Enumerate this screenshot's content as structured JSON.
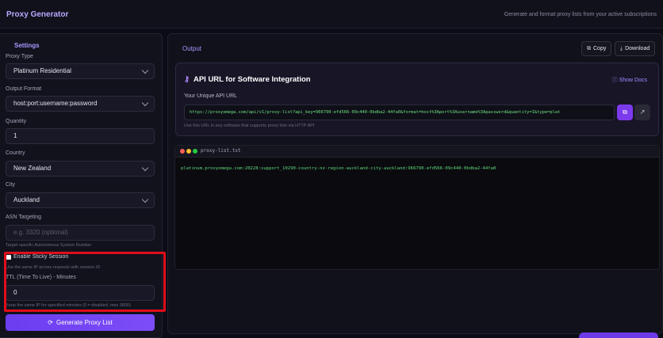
{
  "header": {
    "title": "Proxy Generator",
    "subtitle": "Generate and format proxy lists from your active subscriptions"
  },
  "settings": {
    "heading": "Settings",
    "proxy_type": {
      "label": "Proxy Type",
      "value": "Platinum Residential"
    },
    "output_format": {
      "label": "Output Format",
      "value": "host:port:username:password"
    },
    "quantity": {
      "label": "Quantity",
      "value": "1"
    },
    "country": {
      "label": "Country",
      "value": "New Zealand"
    },
    "city": {
      "label": "City",
      "value": "Auckland"
    },
    "asn": {
      "label": "ASN Targeting",
      "placeholder": "e.g. 3320 (optional)",
      "hint": "Target specific Autonomous System Number"
    },
    "sticky": {
      "label": "Enable Sticky Session",
      "hint": "Use the same IP across requests with session ID",
      "checked": true
    },
    "ttl": {
      "label": "TTL (Time To Live) - Minutes",
      "value": "0",
      "hint": "Keep the same IP for specified minutes (0 = disabled, max 3600)"
    },
    "generate_label": "Generate Proxy List"
  },
  "output": {
    "title": "Output",
    "copy_label": "Copy",
    "download_label": "Download",
    "api": {
      "title": "API URL for Software Integration",
      "docs_label": "Show Docs",
      "url_label": "Your Unique API URL",
      "url": "https://proxyomega.com/api/v1/proxy-list?api_key=966790-efd566-09c440-0bdba2-44fa0&format=host%3Aport%3Ausername%3Apassword&quantity=1&type=plat",
      "url_hint": "Use this URL in any software that supports proxy lists via HTTP API"
    },
    "terminal": {
      "filename": "proxy-list.txt",
      "lines": [
        "platinum.proxyomega.com:20228:support_10290-country-nz-region-auckland-city-auckland:966790-efd566-09c440-0bdba2-44fa0"
      ],
      "dot_colors": [
        "#ff5f57",
        "#febc2e",
        "#28c840"
      ]
    }
  },
  "colors": {
    "accent": "#7c3aed",
    "highlight_border": "#e10d1a"
  }
}
